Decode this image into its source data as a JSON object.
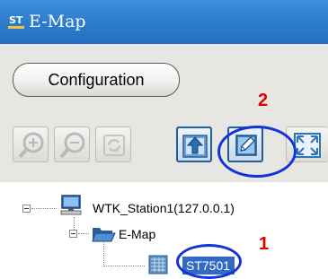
{
  "window": {
    "title": "E-Map"
  },
  "toolbar": {
    "configuration_label": "Configuration",
    "buttons": [
      {
        "name": "zoom-in",
        "icon": "zoom-in-icon",
        "enabled": false
      },
      {
        "name": "zoom-out",
        "icon": "zoom-out-icon",
        "enabled": false
      },
      {
        "name": "refresh",
        "icon": "refresh-icon",
        "enabled": false
      },
      {
        "name": "upload-map",
        "icon": "upload-icon",
        "enabled": true
      },
      {
        "name": "edit",
        "icon": "pencil-icon",
        "enabled": true
      },
      {
        "name": "fit-window",
        "icon": "fit-window-icon",
        "enabled": true
      }
    ]
  },
  "tree": {
    "station": "WTK_Station1(127.0.0.1)",
    "emap": "E-Map",
    "map": "ST7501"
  },
  "annotations": {
    "one": "1",
    "two": "2"
  },
  "colors": {
    "title_bar": "#2f7fcf",
    "panel": "#e7e6e2",
    "callout": "#1133dd",
    "number": "#e00000",
    "selection": "#316ac5"
  }
}
